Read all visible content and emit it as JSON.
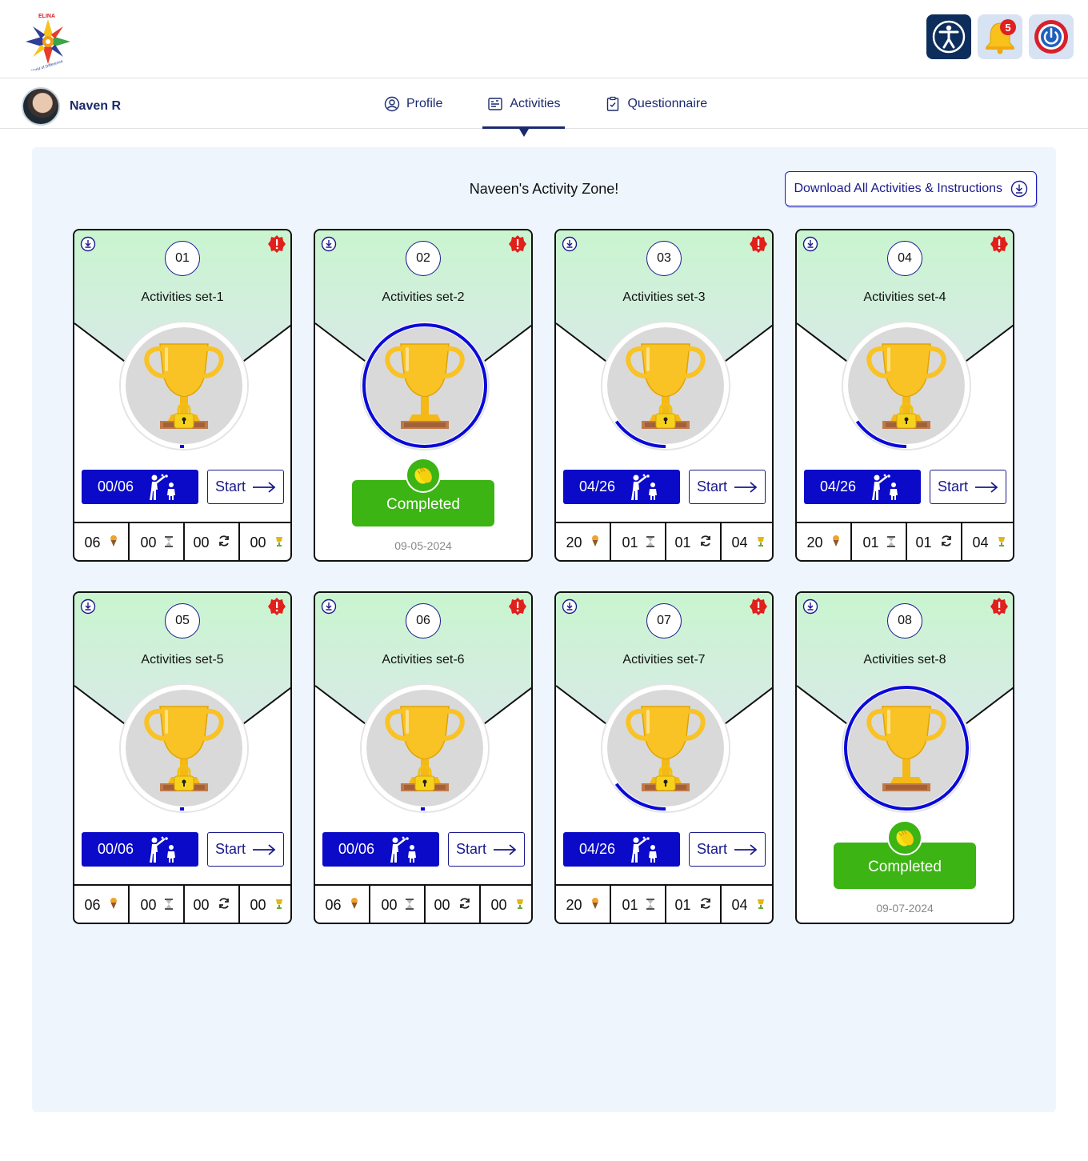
{
  "header": {
    "logo_text": "ELINA",
    "logo_tagline": "A World of Difference",
    "notifications_count": "5"
  },
  "user": {
    "name": "Naven R"
  },
  "tabs": [
    {
      "label": "Profile"
    },
    {
      "label": "Activities"
    },
    {
      "label": "Questionnaire"
    }
  ],
  "active_tab": "Activities",
  "main": {
    "title": "Naveen's Activity Zone!",
    "download_all_label": "Download All Activities & Instructions"
  },
  "colors": {
    "primary": "#0a0ac8",
    "navy": "#1a2a6c",
    "completed_green": "#3cb413",
    "card_top_green": "#c9f5cf",
    "panel_bg": "#eef5fd",
    "alert_red": "#e0201a"
  },
  "cards": [
    {
      "number": "01",
      "title": "Activities set-1",
      "status": "locked",
      "progress_fraction": 0.0,
      "progress_label": "00/06",
      "start_label": "Start",
      "stats": [
        "06",
        "00",
        "00",
        "00"
      ]
    },
    {
      "number": "02",
      "title": "Activities set-2",
      "status": "completed",
      "progress_fraction": 1.0,
      "completed_label": "Completed",
      "date": "09-05-2024"
    },
    {
      "number": "03",
      "title": "Activities set-3",
      "status": "locked",
      "progress_fraction": 0.15,
      "progress_label": "04/26",
      "start_label": "Start",
      "stats": [
        "20",
        "01",
        "01",
        "04"
      ]
    },
    {
      "number": "04",
      "title": "Activities set-4",
      "status": "locked",
      "progress_fraction": 0.15,
      "progress_label": "04/26",
      "start_label": "Start",
      "stats": [
        "20",
        "01",
        "01",
        "04"
      ]
    },
    {
      "number": "05",
      "title": "Activities set-5",
      "status": "locked",
      "progress_fraction": 0.0,
      "progress_label": "00/06",
      "start_label": "Start",
      "stats": [
        "06",
        "00",
        "00",
        "00"
      ]
    },
    {
      "number": "06",
      "title": "Activities set-6",
      "status": "locked",
      "progress_fraction": 0.0,
      "progress_label": "00/06",
      "start_label": "Start",
      "stats": [
        "06",
        "00",
        "00",
        "00"
      ]
    },
    {
      "number": "07",
      "title": "Activities set-7",
      "status": "locked",
      "progress_fraction": 0.15,
      "progress_label": "04/26",
      "start_label": "Start",
      "stats": [
        "20",
        "01",
        "01",
        "04"
      ]
    },
    {
      "number": "08",
      "title": "Activities set-8",
      "status": "completed",
      "progress_fraction": 1.0,
      "completed_label": "Completed",
      "date": "09-07-2024"
    }
  ],
  "stat_icons": [
    "ice-cream-icon",
    "hourglass-icon",
    "refresh-icon",
    "trophy-small-icon"
  ]
}
